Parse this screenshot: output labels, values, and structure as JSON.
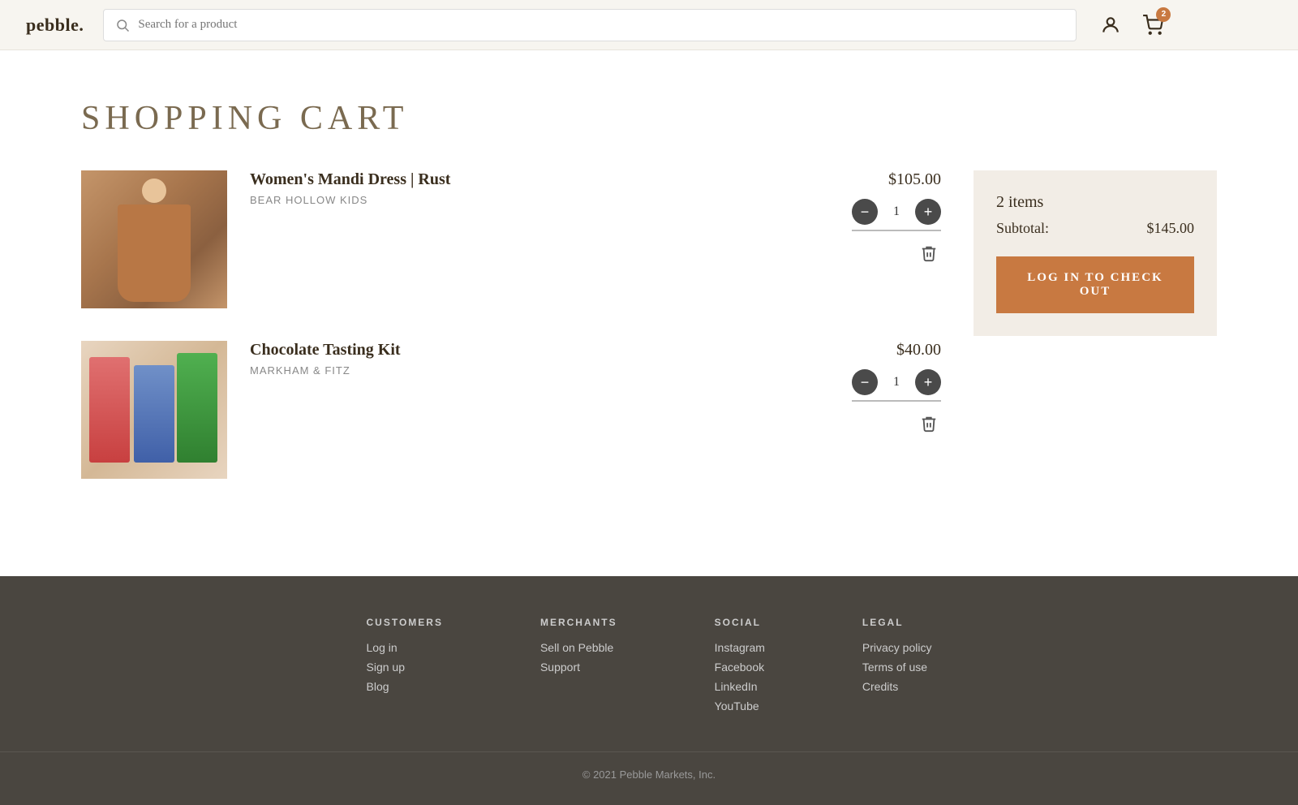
{
  "header": {
    "logo": "pebble.",
    "search_placeholder": "Search for a product",
    "cart_badge": "2"
  },
  "page": {
    "title": "SHOPPING CART"
  },
  "cart": {
    "items": [
      {
        "id": "dress",
        "name": "Women's Mandi Dress | Rust",
        "brand": "Bear Hollow Kids",
        "price": "$105.00",
        "quantity": "1",
        "image_type": "dress"
      },
      {
        "id": "choc",
        "name": "Chocolate Tasting Kit",
        "brand": "MARKHAM & FITZ",
        "price": "$40.00",
        "quantity": "1",
        "image_type": "choc"
      }
    ]
  },
  "summary": {
    "items_count": "2 items",
    "subtotal_label": "Subtotal:",
    "subtotal_value": "$145.00",
    "checkout_label": "LOG IN TO CHECK OUT"
  },
  "footer": {
    "columns": [
      {
        "heading": "CUSTOMERS",
        "links": [
          "Log in",
          "Sign up",
          "Blog"
        ]
      },
      {
        "heading": "MERCHANTS",
        "links": [
          "Sell on Pebble",
          "Support"
        ]
      },
      {
        "heading": "SOCIAL",
        "links": [
          "Instagram",
          "Facebook",
          "LinkedIn",
          "YouTube"
        ]
      },
      {
        "heading": "LEGAL",
        "links": [
          "Privacy policy",
          "Terms of use",
          "Credits"
        ]
      }
    ],
    "copyright": "© 2021 Pebble Markets, Inc."
  }
}
